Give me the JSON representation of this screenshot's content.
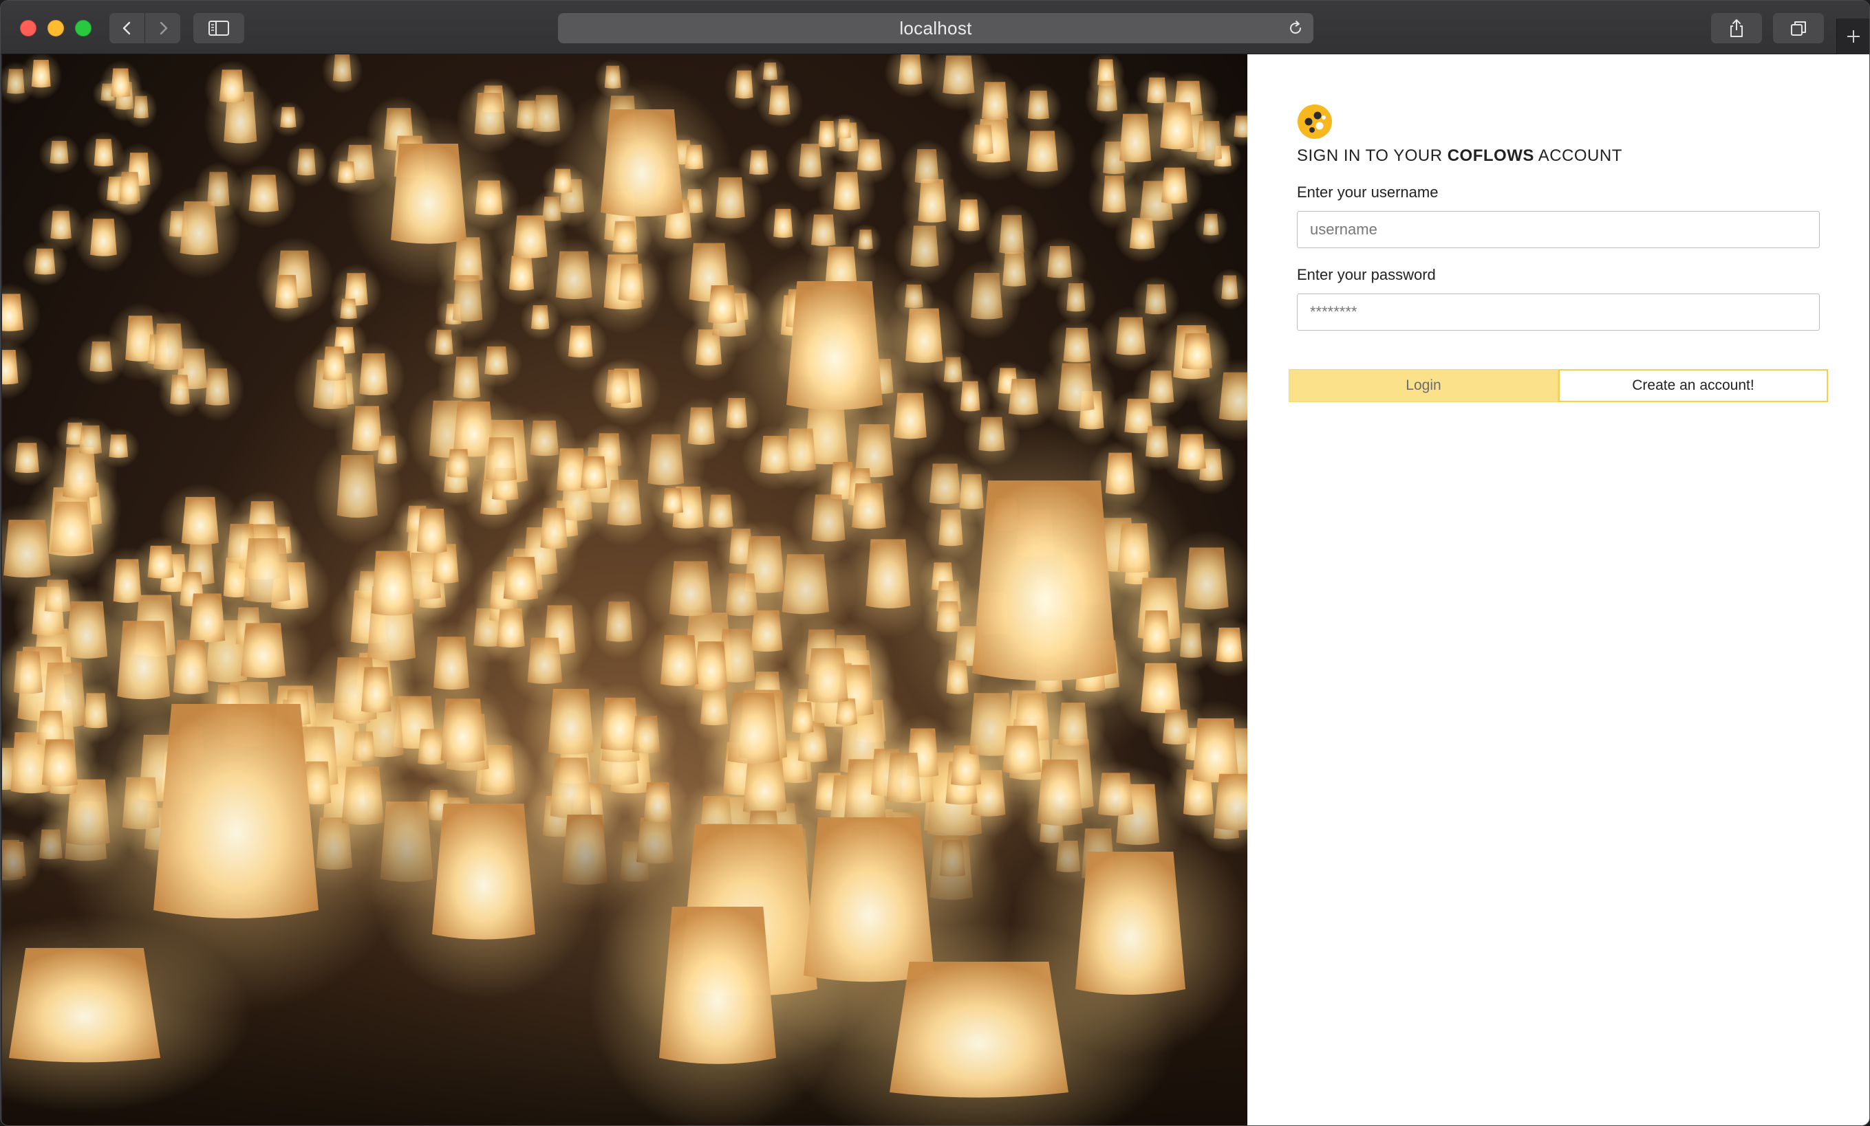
{
  "browser": {
    "url": "localhost"
  },
  "login": {
    "title_prefix": "SIGN IN TO YOUR",
    "title_brand": "COFLOWS",
    "title_suffix": "ACCOUNT",
    "username_label": "Enter your username",
    "username_placeholder": "username",
    "password_label": "Enter your password",
    "password_placeholder": "********",
    "login_button": "Login",
    "create_account_button": "Create an account!"
  },
  "colors": {
    "accent": "#f6cf47",
    "login_button_bg": "#fbe18a",
    "logo_bg": "#f6b81e"
  },
  "icons": {
    "back": "chevron-left-icon",
    "forward": "chevron-right-icon",
    "sidebar": "sidebar-icon",
    "reload": "reload-icon",
    "share": "share-icon",
    "tabs": "tabs-icon",
    "new_tab": "plus-icon",
    "logo": "coflows-logo-icon"
  }
}
